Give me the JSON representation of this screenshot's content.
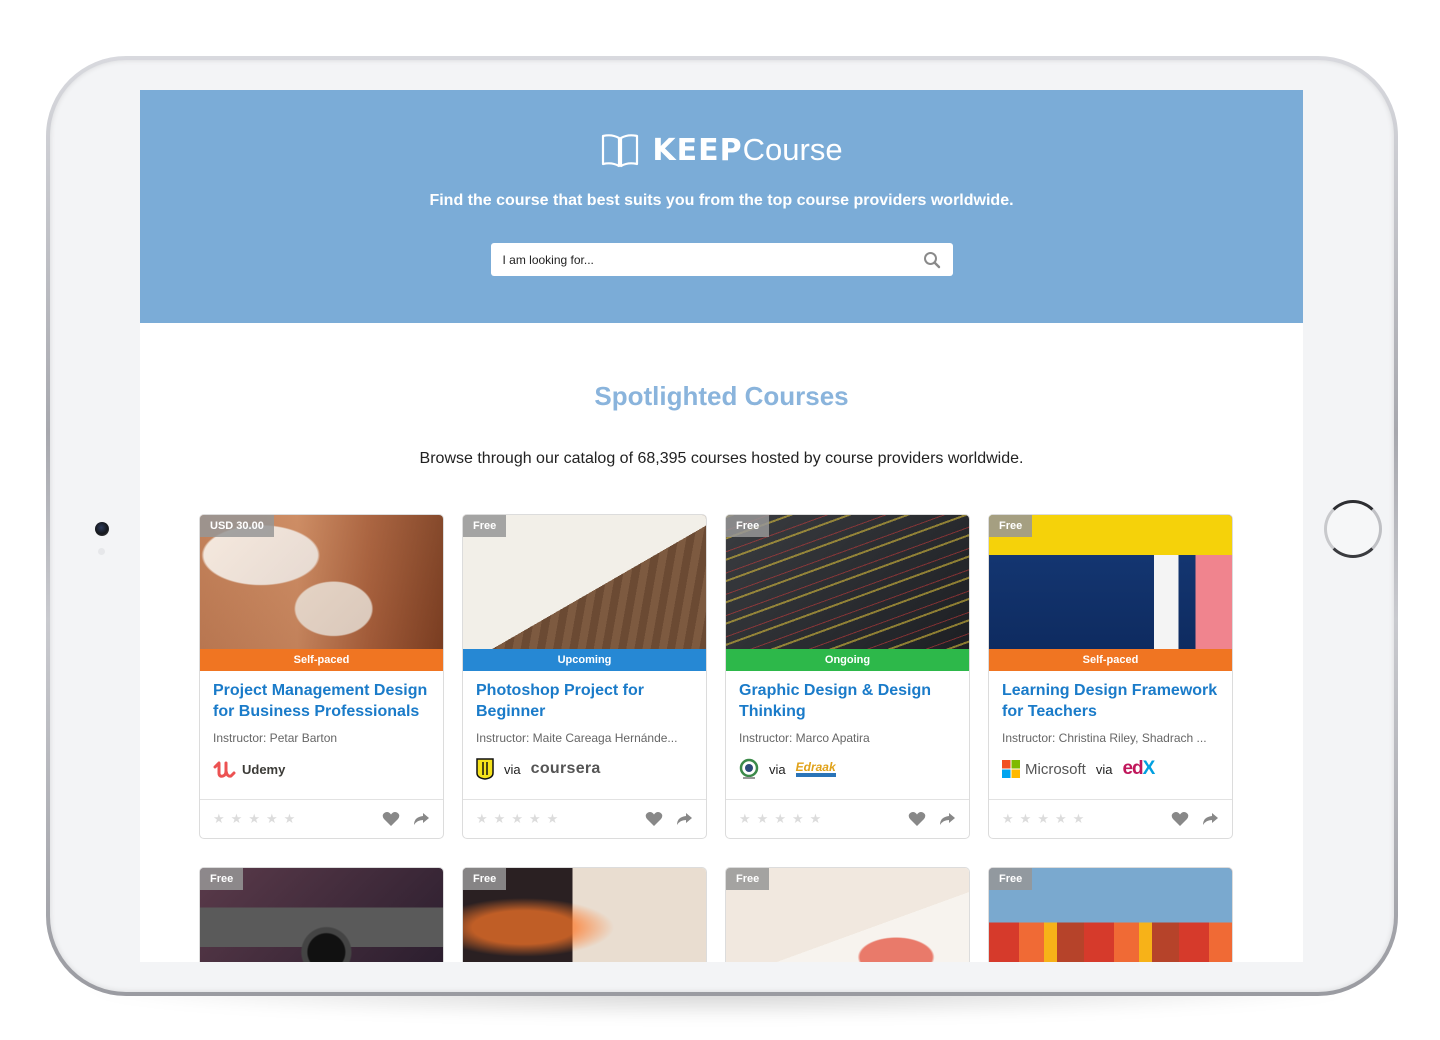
{
  "brand": {
    "name_bold": "KEEP",
    "name_light": "Course",
    "logo_icon": "open-book-icon"
  },
  "hero": {
    "tagline": "Find the course that best suits you from the top course providers worldwide.",
    "search_placeholder": "I am looking for...",
    "search_icon": "search-icon",
    "background_color": "#7bacd7"
  },
  "section": {
    "title": "Spotlighted Courses",
    "subtitle": "Browse through our catalog of 68,395 courses hosted by course providers worldwide."
  },
  "status_colors": {
    "Self-paced": "#f07522",
    "Upcoming": "#2688d4",
    "Ongoing": "#2db84a"
  },
  "courses": [
    {
      "price": "USD 30.00",
      "status": "Self-paced",
      "title": "Project Management Design for Business Professionals",
      "instructor": "Instructor: Petar Barton",
      "institution": "",
      "via": "",
      "provider": "Udemy",
      "rating": 0,
      "favorite_icon": "heart-icon",
      "share_icon": "share-icon"
    },
    {
      "price": "Free",
      "status": "Upcoming",
      "title": "Photoshop Project for Beginner",
      "instructor": "Instructor: Maite Careaga Hernánde...",
      "institution": "university-shield-logo",
      "via": "via",
      "provider": "coursera",
      "rating": 0,
      "favorite_icon": "heart-icon",
      "share_icon": "share-icon"
    },
    {
      "price": "Free",
      "status": "Ongoing",
      "title": "Graphic Design & Design Thinking",
      "instructor": "Instructor: Marco Apatira",
      "institution": "university-seal-logo",
      "via": "via",
      "provider": "Edraak",
      "rating": 0,
      "favorite_icon": "heart-icon",
      "share_icon": "share-icon"
    },
    {
      "price": "Free",
      "status": "Self-paced",
      "title": "Learning Design Framework for Teachers",
      "instructor": "Instructor: Christina Riley, Shadrach ...",
      "institution": "Microsoft",
      "via": "via",
      "provider": "edX",
      "rating": 0,
      "favorite_icon": "heart-icon",
      "share_icon": "share-icon"
    }
  ],
  "courses_row2": [
    {
      "price": "Free",
      "image": "camera"
    },
    {
      "price": "Free",
      "image": "laptop-stylus"
    },
    {
      "price": "Free",
      "image": "watercolor-painting"
    },
    {
      "price": "Free",
      "image": "colorful-building"
    }
  ],
  "rating_max": 5
}
